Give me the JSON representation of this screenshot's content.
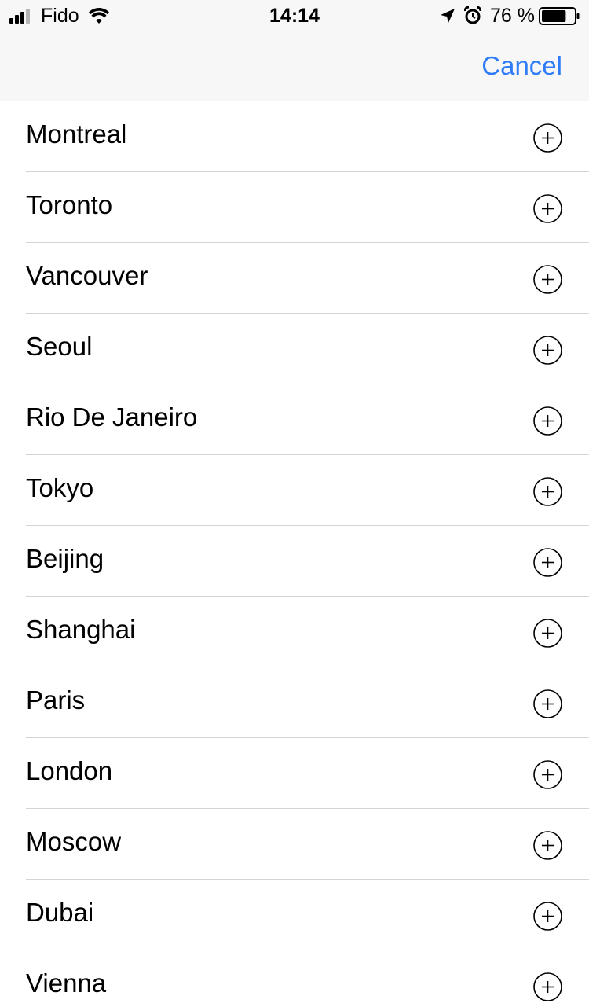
{
  "status_bar": {
    "carrier": "Fido",
    "time": "14:14",
    "battery_percent": "76 %",
    "battery_level": 0.76,
    "icons": [
      "signal-icon",
      "wifi-icon",
      "location-arrow-icon",
      "alarm-clock-icon",
      "battery-icon"
    ]
  },
  "nav": {
    "cancel_label": "Cancel"
  },
  "colors": {
    "accent": "#2f7cf6",
    "bar_background": "#f7f7f7",
    "separator": "#d4d4d4"
  },
  "cities": [
    {
      "name": "Montreal",
      "action_icon": "add-circle-icon"
    },
    {
      "name": "Toronto",
      "action_icon": "add-circle-icon"
    },
    {
      "name": "Vancouver",
      "action_icon": "add-circle-icon"
    },
    {
      "name": "Seoul",
      "action_icon": "add-circle-icon"
    },
    {
      "name": "Rio De Janeiro",
      "action_icon": "add-circle-icon"
    },
    {
      "name": "Tokyo",
      "action_icon": "add-circle-icon"
    },
    {
      "name": "Beijing",
      "action_icon": "add-circle-icon"
    },
    {
      "name": "Shanghai",
      "action_icon": "add-circle-icon"
    },
    {
      "name": "Paris",
      "action_icon": "add-circle-icon"
    },
    {
      "name": "London",
      "action_icon": "add-circle-icon"
    },
    {
      "name": "Moscow",
      "action_icon": "add-circle-icon"
    },
    {
      "name": "Dubai",
      "action_icon": "add-circle-icon"
    },
    {
      "name": "Vienna",
      "action_icon": "add-circle-icon"
    }
  ]
}
